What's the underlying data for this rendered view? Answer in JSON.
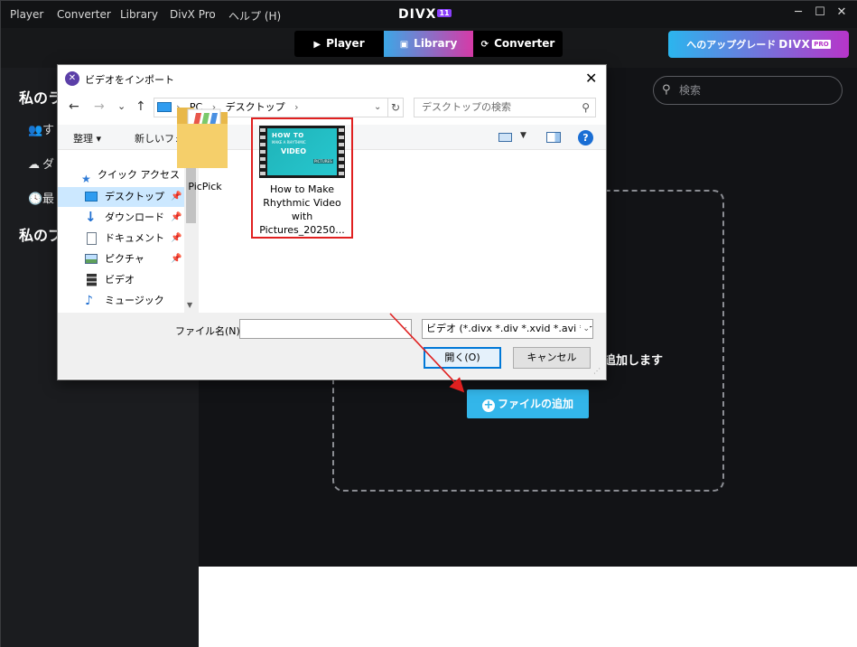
{
  "app": {
    "menu": [
      "Player",
      "Converter",
      "Library",
      "DivX Pro",
      "ヘルプ (H)"
    ],
    "logo_text": "DIVX",
    "logo_version": "11",
    "window_controls": {
      "minimize": "─",
      "maximize": "☐",
      "close": "✕"
    }
  },
  "topbar": {
    "tabs": [
      {
        "label": "Player",
        "icon": "play-icon",
        "glyph": "▶"
      },
      {
        "label": "Library",
        "icon": "library-icon",
        "glyph": "▣"
      },
      {
        "label": "Converter",
        "icon": "convert-icon",
        "glyph": "⟳"
      }
    ],
    "selected_tab": "Library",
    "upgrade": {
      "label": "へのアップグレード",
      "brand": "DIVX",
      "badge": "PRO"
    },
    "search_placeholder": "検索",
    "accent_from": "#3ca7e6",
    "accent_to": "#d63aa7"
  },
  "sidebar": {
    "heading1": "私のラ",
    "items": [
      {
        "label": "す",
        "icon": "people-icon",
        "glyph": "👥"
      },
      {
        "label": "ダ",
        "icon": "cloud-download-icon",
        "glyph": "☁"
      },
      {
        "label": "最",
        "icon": "clock-icon",
        "glyph": "🕓"
      }
    ],
    "heading2": "私のプ"
  },
  "dropzone": {
    "text": "追加します",
    "add_button": "ファイルの追加",
    "add_button_color": "#33b6ea"
  },
  "dialog": {
    "title": "ビデオをインポート",
    "close": "✕",
    "nav": {
      "back": "←",
      "forward": "→",
      "recent": "⌄",
      "up": "↑"
    },
    "address": {
      "crumbs": [
        "PC",
        "デスクトップ"
      ],
      "separator": "›"
    },
    "search_placeholder": "デスクトップの検索",
    "commands": {
      "organize": "整理 ▾",
      "new_folder": "新しいフォルダー",
      "help": "?"
    },
    "nav_pane": {
      "quick_access": "クイック アクセス",
      "items": [
        {
          "label": "デスクトップ",
          "icon": "desktop-icon",
          "pinned": true,
          "selected": true
        },
        {
          "label": "ダウンロード",
          "icon": "download-icon",
          "pinned": true,
          "selected": false
        },
        {
          "label": "ドキュメント",
          "icon": "document-icon",
          "pinned": true,
          "selected": false
        },
        {
          "label": "ピクチャ",
          "icon": "picture-icon",
          "pinned": true,
          "selected": false
        },
        {
          "label": "ビデオ",
          "icon": "video-icon",
          "pinned": false,
          "selected": false
        },
        {
          "label": "ミュージック",
          "icon": "music-icon",
          "pinned": false,
          "selected": false
        }
      ]
    },
    "files": [
      {
        "name": "PicPick",
        "type": "folder"
      },
      {
        "name": "How to Make Rhythmic Video with Pictures_20250...",
        "type": "video",
        "selected": true,
        "thumb": {
          "line1": "HOW TO",
          "line2": "MAKE A RHYTHMIC",
          "line3": "VIDEO",
          "line4": "PICTURES"
        }
      }
    ],
    "video_label_lines": [
      "How to Make",
      "Rhythmic Video",
      "with",
      "Pictures_20250..."
    ],
    "filename_label": "ファイル名(N):",
    "filename_value": "",
    "filter": "ビデオ (*.divx *.div *.xvid *.avi *.r",
    "open_button": "開く(O)",
    "cancel_button": "キャンセル",
    "highlight_color": "#e02020"
  }
}
